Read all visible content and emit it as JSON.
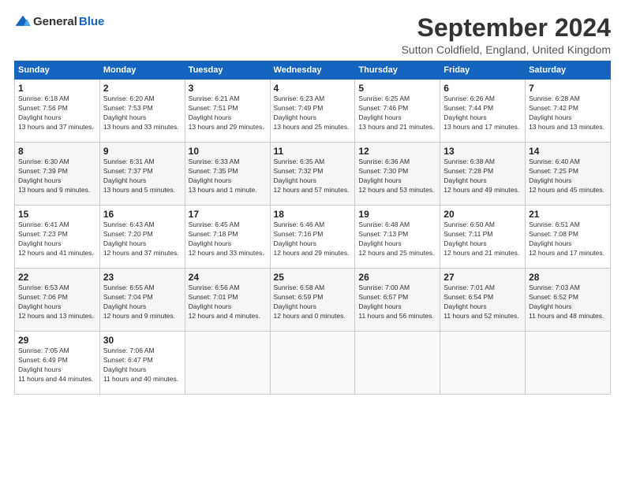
{
  "logo": {
    "general": "General",
    "blue": "Blue"
  },
  "header": {
    "title": "September 2024",
    "subtitle": "Sutton Coldfield, England, United Kingdom"
  },
  "days_of_week": [
    "Sunday",
    "Monday",
    "Tuesday",
    "Wednesday",
    "Thursday",
    "Friday",
    "Saturday"
  ],
  "weeks": [
    [
      {
        "day": "1",
        "sunrise": "6:18 AM",
        "sunset": "7:56 PM",
        "daylight": "13 hours and 37 minutes."
      },
      {
        "day": "2",
        "sunrise": "6:20 AM",
        "sunset": "7:53 PM",
        "daylight": "13 hours and 33 minutes."
      },
      {
        "day": "3",
        "sunrise": "6:21 AM",
        "sunset": "7:51 PM",
        "daylight": "13 hours and 29 minutes."
      },
      {
        "day": "4",
        "sunrise": "6:23 AM",
        "sunset": "7:49 PM",
        "daylight": "13 hours and 25 minutes."
      },
      {
        "day": "5",
        "sunrise": "6:25 AM",
        "sunset": "7:46 PM",
        "daylight": "13 hours and 21 minutes."
      },
      {
        "day": "6",
        "sunrise": "6:26 AM",
        "sunset": "7:44 PM",
        "daylight": "13 hours and 17 minutes."
      },
      {
        "day": "7",
        "sunrise": "6:28 AM",
        "sunset": "7:42 PM",
        "daylight": "13 hours and 13 minutes."
      }
    ],
    [
      {
        "day": "8",
        "sunrise": "6:30 AM",
        "sunset": "7:39 PM",
        "daylight": "13 hours and 9 minutes."
      },
      {
        "day": "9",
        "sunrise": "6:31 AM",
        "sunset": "7:37 PM",
        "daylight": "13 hours and 5 minutes."
      },
      {
        "day": "10",
        "sunrise": "6:33 AM",
        "sunset": "7:35 PM",
        "daylight": "13 hours and 1 minute."
      },
      {
        "day": "11",
        "sunrise": "6:35 AM",
        "sunset": "7:32 PM",
        "daylight": "12 hours and 57 minutes."
      },
      {
        "day": "12",
        "sunrise": "6:36 AM",
        "sunset": "7:30 PM",
        "daylight": "12 hours and 53 minutes."
      },
      {
        "day": "13",
        "sunrise": "6:38 AM",
        "sunset": "7:28 PM",
        "daylight": "12 hours and 49 minutes."
      },
      {
        "day": "14",
        "sunrise": "6:40 AM",
        "sunset": "7:25 PM",
        "daylight": "12 hours and 45 minutes."
      }
    ],
    [
      {
        "day": "15",
        "sunrise": "6:41 AM",
        "sunset": "7:23 PM",
        "daylight": "12 hours and 41 minutes."
      },
      {
        "day": "16",
        "sunrise": "6:43 AM",
        "sunset": "7:20 PM",
        "daylight": "12 hours and 37 minutes."
      },
      {
        "day": "17",
        "sunrise": "6:45 AM",
        "sunset": "7:18 PM",
        "daylight": "12 hours and 33 minutes."
      },
      {
        "day": "18",
        "sunrise": "6:46 AM",
        "sunset": "7:16 PM",
        "daylight": "12 hours and 29 minutes."
      },
      {
        "day": "19",
        "sunrise": "6:48 AM",
        "sunset": "7:13 PM",
        "daylight": "12 hours and 25 minutes."
      },
      {
        "day": "20",
        "sunrise": "6:50 AM",
        "sunset": "7:11 PM",
        "daylight": "12 hours and 21 minutes."
      },
      {
        "day": "21",
        "sunrise": "6:51 AM",
        "sunset": "7:08 PM",
        "daylight": "12 hours and 17 minutes."
      }
    ],
    [
      {
        "day": "22",
        "sunrise": "6:53 AM",
        "sunset": "7:06 PM",
        "daylight": "12 hours and 13 minutes."
      },
      {
        "day": "23",
        "sunrise": "6:55 AM",
        "sunset": "7:04 PM",
        "daylight": "12 hours and 9 minutes."
      },
      {
        "day": "24",
        "sunrise": "6:56 AM",
        "sunset": "7:01 PM",
        "daylight": "12 hours and 4 minutes."
      },
      {
        "day": "25",
        "sunrise": "6:58 AM",
        "sunset": "6:59 PM",
        "daylight": "12 hours and 0 minutes."
      },
      {
        "day": "26",
        "sunrise": "7:00 AM",
        "sunset": "6:57 PM",
        "daylight": "11 hours and 56 minutes."
      },
      {
        "day": "27",
        "sunrise": "7:01 AM",
        "sunset": "6:54 PM",
        "daylight": "11 hours and 52 minutes."
      },
      {
        "day": "28",
        "sunrise": "7:03 AM",
        "sunset": "6:52 PM",
        "daylight": "11 hours and 48 minutes."
      }
    ],
    [
      {
        "day": "29",
        "sunrise": "7:05 AM",
        "sunset": "6:49 PM",
        "daylight": "11 hours and 44 minutes."
      },
      {
        "day": "30",
        "sunrise": "7:06 AM",
        "sunset": "6:47 PM",
        "daylight": "11 hours and 40 minutes."
      },
      null,
      null,
      null,
      null,
      null
    ]
  ]
}
